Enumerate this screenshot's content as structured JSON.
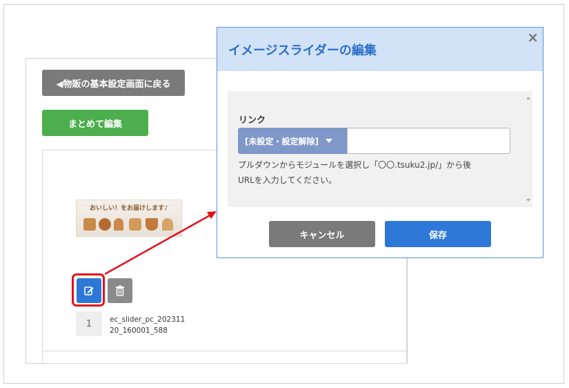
{
  "background_page": {
    "back_button_label": "◀物販の基本設定画面に戻る",
    "bulk_edit_label": "まとめて編集",
    "slider_item": {
      "thumbnail_caption": "おいしい！をお届けします♪",
      "index": "1",
      "filename": "ec_slider_pc_20231120_160001_588"
    }
  },
  "modal": {
    "title": "イメージスライダーの編集",
    "close_glyph": "×",
    "link_label": "リンク",
    "link_select_value": "[未設定・設定解除]",
    "link_input_value": "",
    "help_text_line1": "プルダウンからモジュールを選択し「〇〇.tsuku2.jp/」から後",
    "help_text_line2": "URLを入力してください。",
    "cancel_label": "キャンセル",
    "save_label": "保存"
  },
  "colors": {
    "accent_blue": "#2d78d6",
    "header_bg": "#d2e3f7",
    "highlight_red": "#e3101a",
    "bulk_green": "#4cae4c",
    "gray_button": "#7a7a7a"
  }
}
